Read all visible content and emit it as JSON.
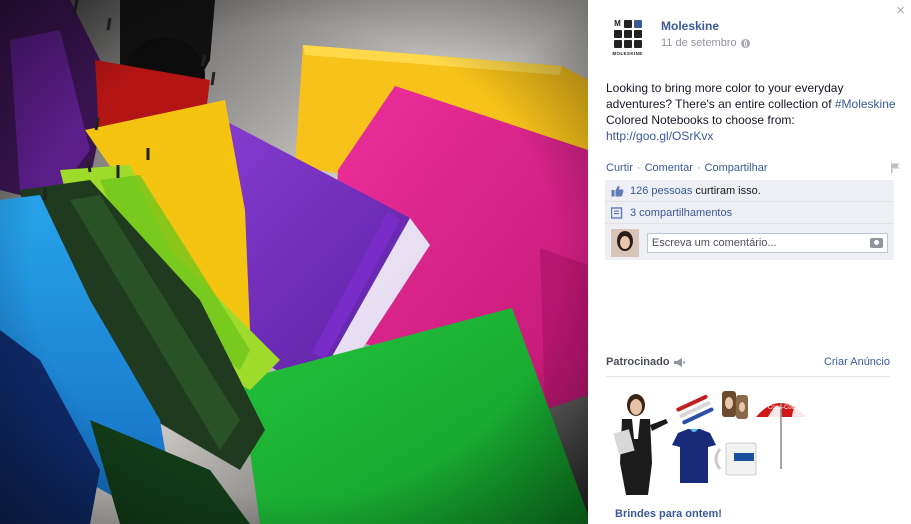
{
  "photo": {
    "alt_subject": "colored-notebooks-and-umbrellas"
  },
  "post": {
    "page_name": "Moleskine",
    "logo_text": "MOLESKINE",
    "date": "11 de setembro",
    "text_before_hashtag": "Looking to bring more color to your everyday adventures? There's an entire collection of ",
    "hashtag": "#Moleskine",
    "text_after_hashtag": " Colored Notebooks to choose from: ",
    "link": "http://goo.gl/OSrKvx"
  },
  "actions": {
    "like": "Curtir",
    "comment": "Comentar",
    "share": "Compartilhar",
    "separator": "·"
  },
  "ufi": {
    "likes_link": "126 pessoas",
    "likes_suffix": "curtiram isso.",
    "shares_link": "3 compartilhamentos",
    "comment_placeholder": "Escreva um comentário..."
  },
  "sponsored": {
    "label": "Patrocinado",
    "create_ad": "Criar Anúncio",
    "ad_title": "Brindes para ontem!"
  },
  "window": {
    "close_glyph": "×"
  },
  "colors": {
    "fb_blue": "#3b5998",
    "meta_gray": "#90949c",
    "ufi_bg": "#edeff4"
  }
}
